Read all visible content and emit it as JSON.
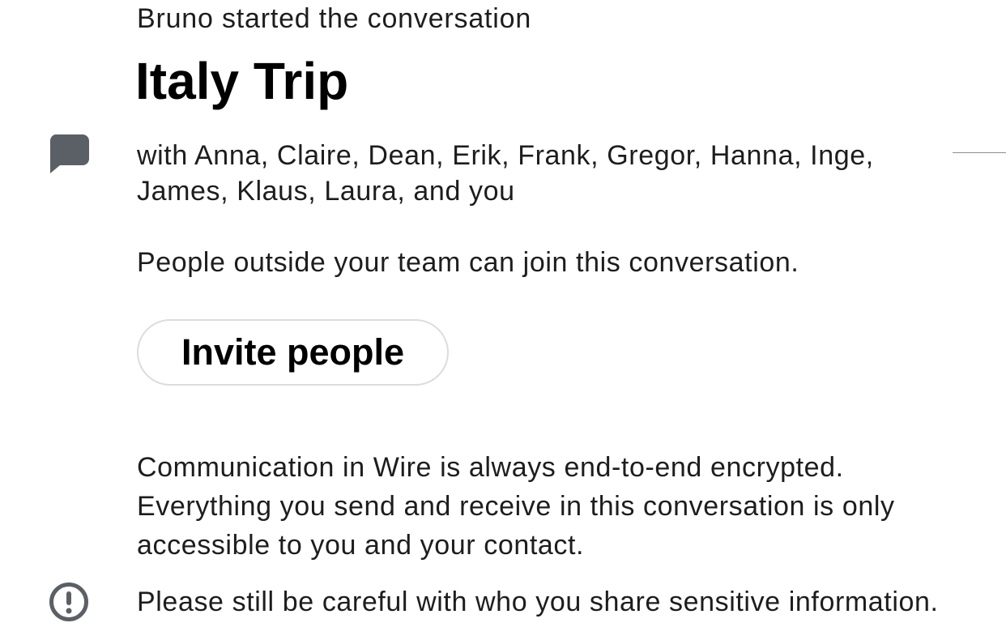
{
  "conversation": {
    "started_text": "Bruno started the conversation",
    "title": "Italy Trip",
    "participants_text": "with Anna, Claire, Dean, Erik, Frank, Gregor, Hanna, Inge, James, Klaus, Laura, and you",
    "guests_notice": "People outside your team can join this conversation.",
    "invite_label": "Invite people"
  },
  "security": {
    "encryption_text": "Communication in Wire is always end-to-end encrypted. Everything you send and receive in this conversation is only accessible to you and your contact.",
    "warning_text": "Please still be careful with who you share sensitive information."
  },
  "icons": {
    "conversation": "message-bubble-icon",
    "warning": "exclamation-circle-icon"
  },
  "colors": {
    "icon": "#5b5f66",
    "text": "#1d1d1f",
    "button_border": "#dcdcdf",
    "divider": "#8e8e93"
  }
}
